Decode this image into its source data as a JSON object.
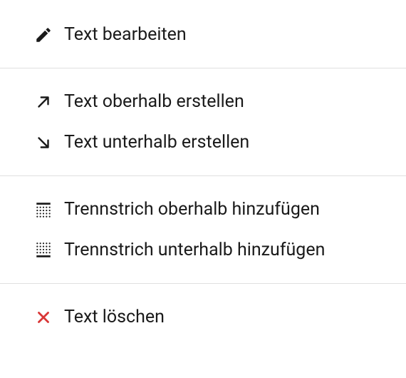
{
  "menu": {
    "groups": [
      {
        "items": [
          {
            "label": "Text bearbeiten"
          }
        ]
      },
      {
        "items": [
          {
            "label": "Text oberhalb erstellen"
          },
          {
            "label": "Text unterhalb erstellen"
          }
        ]
      },
      {
        "items": [
          {
            "label": "Trennstrich oberhalb hinzufügen"
          },
          {
            "label": "Trennstrich unterhalb hinzufügen"
          }
        ]
      },
      {
        "items": [
          {
            "label": "Text löschen"
          }
        ]
      }
    ]
  },
  "colors": {
    "delete_icon": "#d93636"
  }
}
